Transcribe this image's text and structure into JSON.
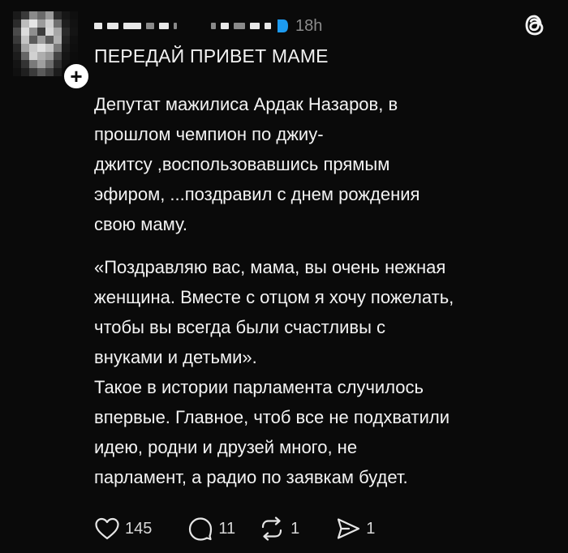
{
  "post": {
    "timestamp": "18h",
    "title": "ПЕРЕДАЙ ПРИВЕТ МАМЕ",
    "paragraphs": [
      "Депутат мажилиса Ардак Назаров, в прошлом чемпион по джиу-джитсу ,воспользовавшись прямым эфиром, ...поздравил с днем рождения свою маму.",
      "«Поздравляю вас, мама, вы очень нежная женщина. Вместе с отцом я хочу пожелать, чтобы вы всегда были  счастливы с внуками и детьми».",
      "Такое в истории парламента случилось впервые. Главное, чтоб все не подхватили идею, родни и друзей много, не парламент, а радио по заявкам будет."
    ],
    "body_lines": {
      "p1": [
        "Депутат мажилиса Ардак Назаров, в",
        "прошлом чемпион по джиу-",
        "джитсу ,воспользовавшись прямым",
        "эфиром, ...поздравил с днем рождения",
        "свою маму."
      ],
      "p2": [
        "«Поздравляю вас, мама, вы очень нежная",
        "женщина. Вместе с отцом я хочу пожелать,",
        "чтобы вы всегда были  счастливы с",
        "внуками и детьми»."
      ],
      "p3": [
        "Такое в истории парламента случилось",
        "впервые. Главное, чтоб все не подхватили",
        "идею, родни и друзей много, не",
        "парламент, а радио по заявкам будет."
      ]
    }
  },
  "actions": {
    "likes": "145",
    "replies": "11",
    "reposts": "1",
    "shares": "1"
  },
  "icons": {
    "like": "heart-icon",
    "reply": "comment-icon",
    "repost": "repost-icon",
    "share": "send-icon",
    "brand": "threads-icon",
    "verified": "verified-badge-icon",
    "follow": "plus-icon"
  },
  "colors": {
    "background": "#0a0a0a",
    "text": "#f3f3f3",
    "muted": "#8b8b8b",
    "verified": "#1d9bf0"
  }
}
